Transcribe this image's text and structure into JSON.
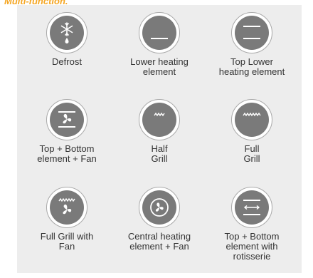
{
  "header": {
    "title": "Multi-function."
  },
  "functions": [
    {
      "icon": "snowflake-drop-icon",
      "label": "Defrost"
    },
    {
      "icon": "lower-heating-icon",
      "label": "Lower heating\nelement"
    },
    {
      "icon": "top-lower-heating-icon",
      "label": "Top Lower\nheating element"
    },
    {
      "icon": "top-bottom-fan-icon",
      "label": "Top  + Bottom\nelement + Fan"
    },
    {
      "icon": "half-grill-icon",
      "label": "Half\nGrill"
    },
    {
      "icon": "full-grill-icon",
      "label": "Full\nGrill"
    },
    {
      "icon": "full-grill-fan-icon",
      "label": "Full Grill with\nFan"
    },
    {
      "icon": "central-heating-fan-icon",
      "label": "Central heating\nelement + Fan"
    },
    {
      "icon": "top-bottom-rotisserie-icon",
      "label": "Top + Bottom\nelement with\nrotisserie"
    }
  ]
}
